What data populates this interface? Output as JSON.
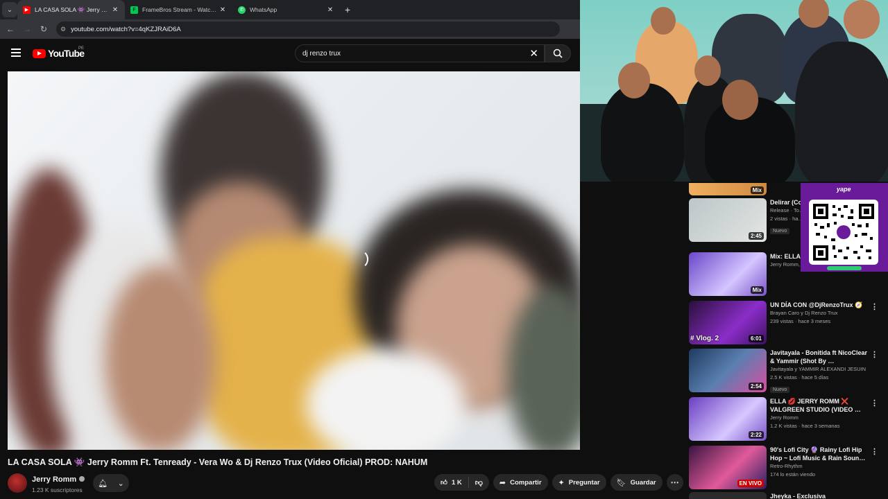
{
  "browser": {
    "tabs": [
      {
        "label": "LA CASA SOLA 👾 Jerry Romm",
        "active": true,
        "favicon": "youtube-icon",
        "color": "#ff0000"
      },
      {
        "label": "FrameBros Stream - Watch Live",
        "active": false,
        "favicon": "framebros-icon",
        "color": "#00c853"
      },
      {
        "label": "WhatsApp",
        "active": false,
        "favicon": "whatsapp-icon",
        "color": "#25d366"
      }
    ],
    "new_tab": "+",
    "url": "youtube.com/watch?v=4qKZJRAiD6A"
  },
  "youtube": {
    "logo_text": "YouTube",
    "country_code": "PE",
    "search_value": "dj renzo trux",
    "clear_icon": "close-icon",
    "search_icon": "search-icon"
  },
  "video": {
    "title": "LA CASA SOLA 👾 Jerry Romm Ft. Tenready - Vera Wo & Dj Renzo Trux (Video Oficial) PROD: NAHUM",
    "channel": "Jerry Romm",
    "subscribers": "1.23 K suscriptores",
    "likes": "1 K",
    "share": "Compartir",
    "ask": "Preguntar",
    "save": "Guardar"
  },
  "sidebar": {
    "items": [
      {
        "title": "Delirar (Co… engenhari…",
        "line1": "Release · To…",
        "line2": "2 vistas · ha…",
        "badge": "2:45",
        "nuevo": "Nuevo",
        "colors": [
          "#b9c3c5",
          "#d7dcd9"
        ]
      },
      {
        "title": "Mix: ELLA… VALGREEN…",
        "line1": "Jerry Romm, Liz Afra, Alan AC y muchos …",
        "line2": "",
        "badge": "Mix",
        "colors": [
          "#5b3fa8",
          "#c3b2ff"
        ]
      },
      {
        "title": "UN DÍA CON @DjRenzoTrux 🧭",
        "line1": "Brayan Caro y Dj Renzo Trux",
        "line2": "239 vistas · hace 3 meses",
        "badge": "6:01",
        "vlog": "# Vlog. 2",
        "colors": [
          "#2a0f3a",
          "#8a2ec9"
        ]
      },
      {
        "title": "Javitayala - Bonitida ft NicoClear & Yammir (Shot By …",
        "line1": "Javitayala y YAMMIR ALEXANDI JESUIN",
        "line2": "2.5 K vistas · hace 5 días",
        "badge": "2:54",
        "nuevo": "Nuevo",
        "colors": [
          "#1e3a5f",
          "#d94da0"
        ]
      },
      {
        "title": "ELLA 💋 JERRY ROMM ❌ VALGREEN STUDIO (VIDEO …",
        "line1": "Jerry Romm",
        "line2": "1.2 K vistas · hace 3 semanas",
        "badge": "2:22",
        "colors": [
          "#6a3fc2",
          "#d6c7ff"
        ]
      },
      {
        "title": "90's Lofi City 🔮 Rainy Lofi Hip Hop ~ Lofi Music & Rain Soun…",
        "line1": "Retro-Rhythm",
        "line2": "174 lo están viendo",
        "badge": "EN VIVO",
        "live": true,
        "colors": [
          "#3a1440",
          "#e05a9a"
        ]
      },
      {
        "title": "Jheyka - Exclusiva",
        "line1": "",
        "line2": "",
        "badge": "",
        "colors": [
          "#333",
          "#555"
        ]
      }
    ],
    "top_badge": "Mix"
  },
  "qr": {
    "brand": "yape"
  }
}
